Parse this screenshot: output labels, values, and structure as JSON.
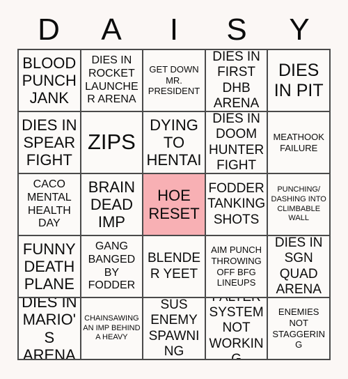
{
  "card": {
    "header_letters": [
      "D",
      "A",
      "I",
      "S",
      "Y"
    ],
    "marked_color": "#F8B0B4",
    "background_color": "#FBF7F5",
    "cell_color": "#FCFAF8",
    "border_color": "#4A4A4A",
    "text_color": "#0B0B0B",
    "rows": 5,
    "columns": 5,
    "cells": [
      {
        "text": "BLOOD PUNCH JANK",
        "marked": false,
        "size": "xl"
      },
      {
        "text": "DIES IN ROCKET LAUNCHER ARENA",
        "marked": false,
        "size": "md"
      },
      {
        "text": "GET DOWN MR. PRESIDENT",
        "marked": false,
        "size": "sm"
      },
      {
        "text": "DIES IN FIRST DHB ARENA",
        "marked": false,
        "size": "lg"
      },
      {
        "text": "DIES IN PIT",
        "marked": false,
        "size": "xxl"
      },
      {
        "text": "DIES IN SPEAR FIGHT",
        "marked": false,
        "size": "xl"
      },
      {
        "text": "ZIPS",
        "marked": false,
        "size": "zip"
      },
      {
        "text": "DYING TO HENTAI",
        "marked": false,
        "size": "xl"
      },
      {
        "text": "DIES IN DOOM HUNTER FIGHT",
        "marked": false,
        "size": "lg"
      },
      {
        "text": "MEATHOOK FAILURE",
        "marked": false,
        "size": "sm"
      },
      {
        "text": "CACO MENTAL HEALTH DAY",
        "marked": false,
        "size": "md"
      },
      {
        "text": "BRAIN DEAD IMP",
        "marked": false,
        "size": "xl"
      },
      {
        "text": "HOE RESET",
        "marked": true,
        "size": "xl"
      },
      {
        "text": "FODDER TANKING SHOTS",
        "marked": false,
        "size": "lg"
      },
      {
        "text": "PUNCHING/ DASHING INTO CLIMBABLE WALL",
        "marked": false,
        "size": "xs"
      },
      {
        "text": "FUNNY DEATH PLANE",
        "marked": false,
        "size": "xl"
      },
      {
        "text": "GANG BANGED BY FODDER",
        "marked": false,
        "size": "md"
      },
      {
        "text": "BLENDER YEET",
        "marked": false,
        "size": "lg"
      },
      {
        "text": "AIM PUNCH THROWING OFF BFG LINEUPS",
        "marked": false,
        "size": "sm"
      },
      {
        "text": "DIES IN SGN QUAD ARENA",
        "marked": false,
        "size": "lg"
      },
      {
        "text": "DIES IN MARIO'S ARENA",
        "marked": false,
        "size": "xl"
      },
      {
        "text": "CHAINSAWING AN IMP BEHIND A HEAVY",
        "marked": false,
        "size": "xs"
      },
      {
        "text": "SUS ENEMY SPAWNING",
        "marked": false,
        "size": "lg"
      },
      {
        "text": "FALTER SYSTEM NOT WORKING",
        "marked": false,
        "size": "lg"
      },
      {
        "text": "ENEMIES NOT STAGGERING",
        "marked": false,
        "size": "sm"
      }
    ]
  }
}
